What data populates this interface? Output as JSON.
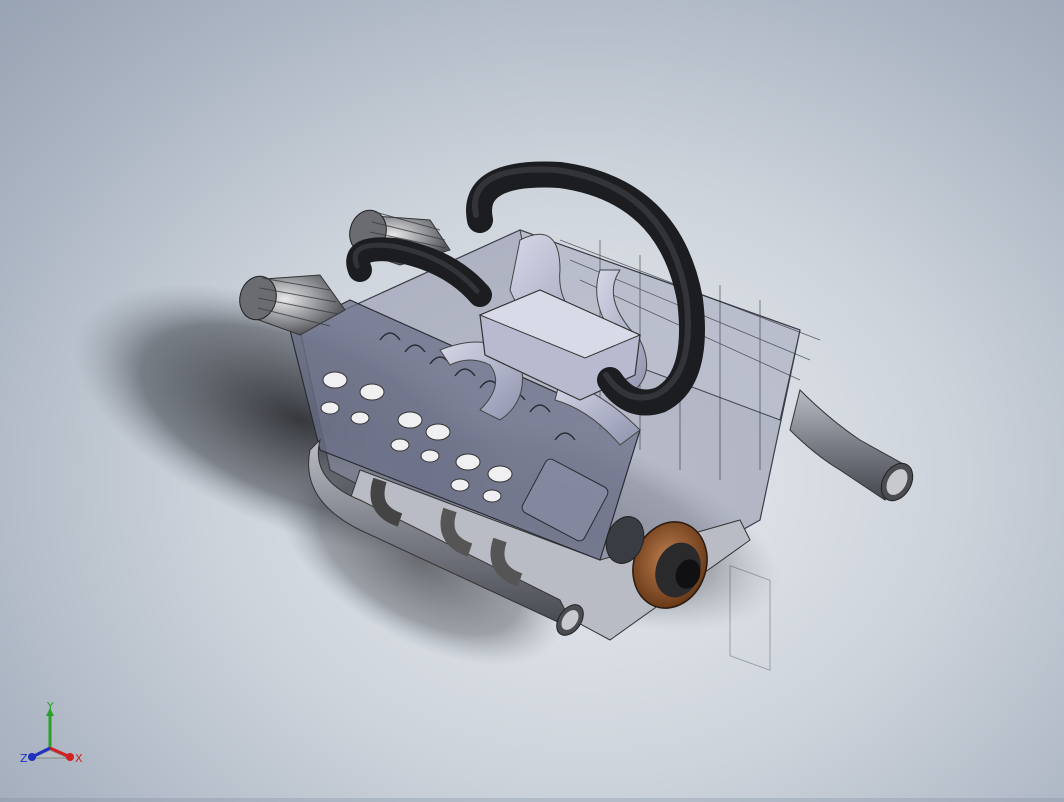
{
  "viewport": {
    "model": "v8-engine-assembly",
    "background_top": "#98a3b3",
    "background_center": "#e9ecf0"
  },
  "triad": {
    "x_label": "X",
    "y_label": "Y",
    "z_label": "Z",
    "x_color": "#d22020",
    "y_color": "#2aa02a",
    "z_color": "#2030c0"
  }
}
